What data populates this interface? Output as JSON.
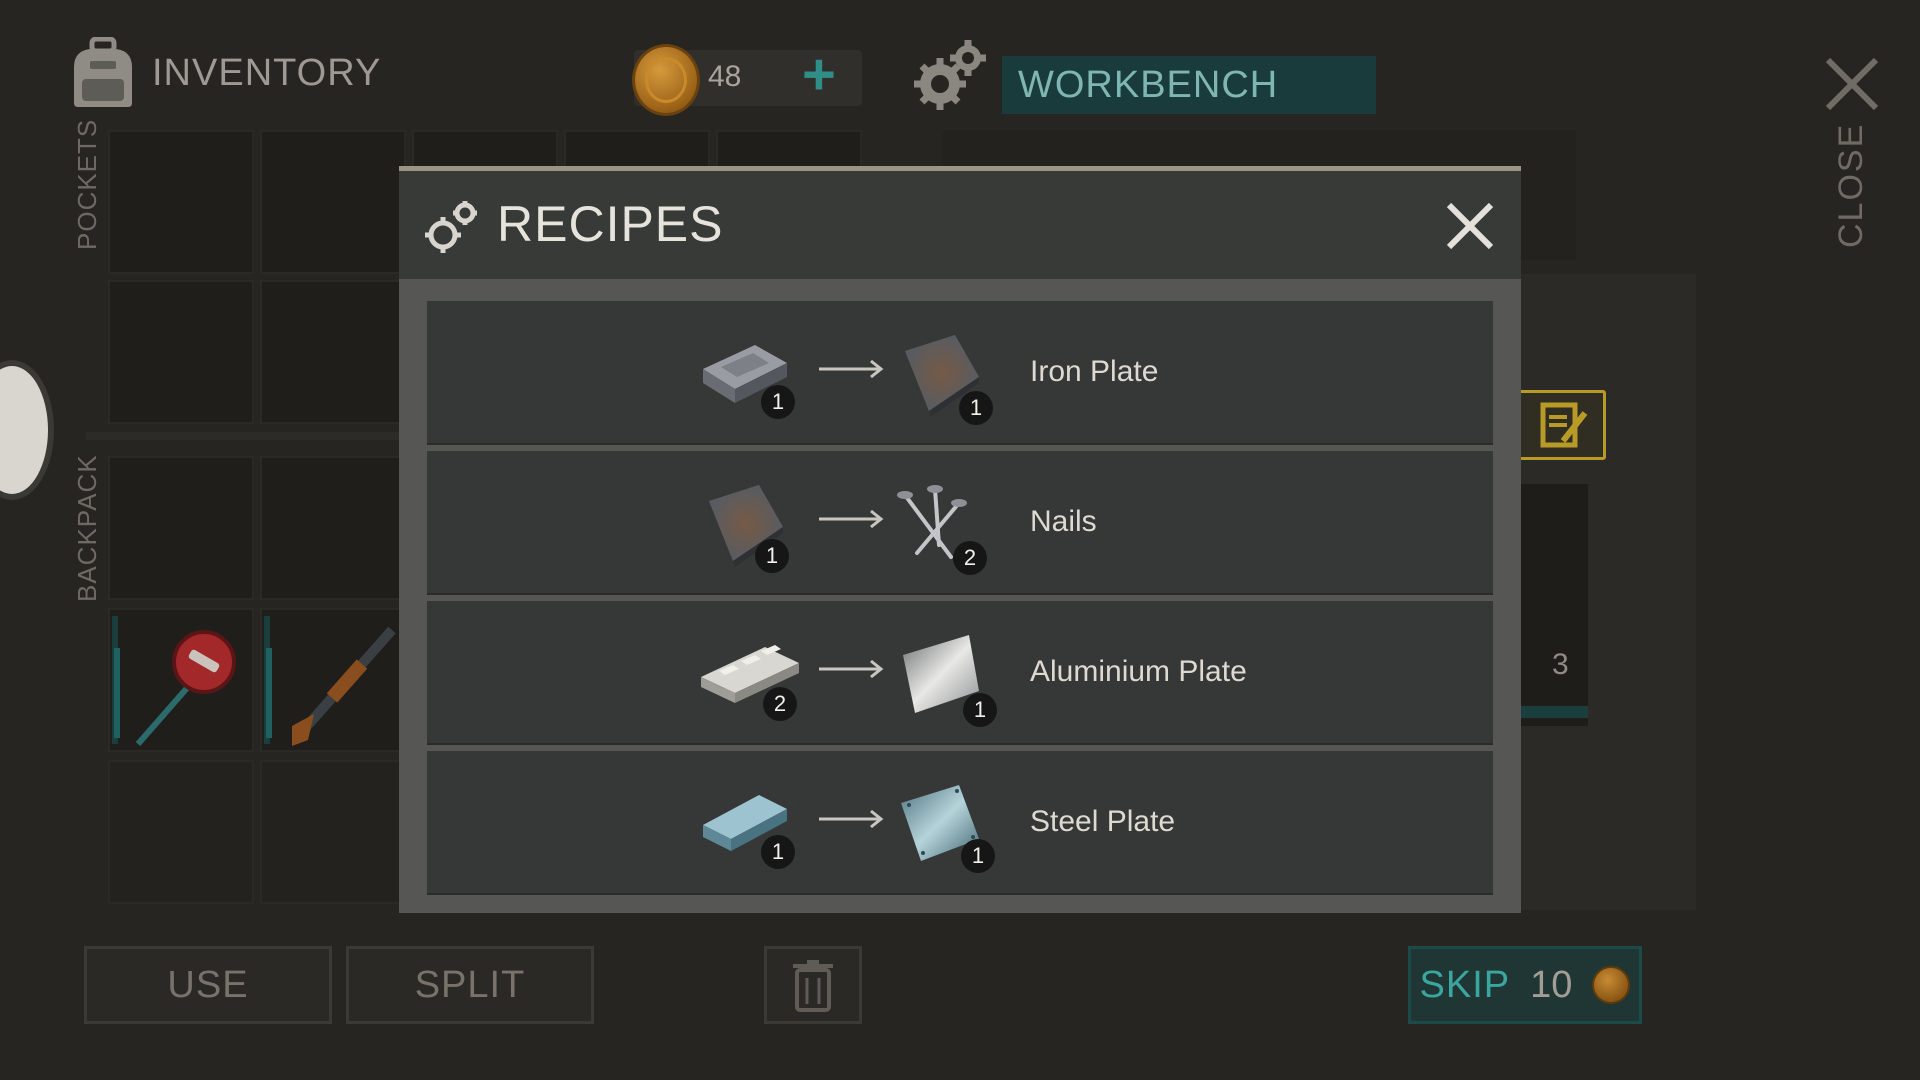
{
  "inventory": {
    "title": "INVENTORY",
    "pockets_label": "POCKETS",
    "backpack_label": "BACKPACK",
    "coins": "48",
    "add_label": "+"
  },
  "workbench": {
    "title": "WORKBENCH",
    "close_label": "CLOSE",
    "item_count": "3"
  },
  "actions": {
    "use_label": "USE",
    "split_label": "SPLIT",
    "skip_label": "SKIP",
    "skip_cost": "10"
  },
  "recipes_modal": {
    "title": "RECIPES",
    "recipes": [
      {
        "name": "Iron Plate",
        "input_icon": "iron-ingot-icon",
        "input_qty": "1",
        "output_icon": "iron-plate-icon",
        "output_qty": "1"
      },
      {
        "name": "Nails",
        "input_icon": "iron-plate-icon",
        "input_qty": "1",
        "output_icon": "nails-icon",
        "output_qty": "2"
      },
      {
        "name": "Aluminium Plate",
        "input_icon": "aluminium-bars-icon",
        "input_qty": "2",
        "output_icon": "aluminium-plate-icon",
        "output_qty": "1"
      },
      {
        "name": "Steel Plate",
        "input_icon": "steel-ingot-icon",
        "input_qty": "1",
        "output_icon": "steel-plate-icon",
        "output_qty": "1"
      }
    ]
  },
  "colors": {
    "accent_teal": "#2f8f88",
    "workbench_bg": "#193b3b",
    "note_border": "#b89a26",
    "modal_bg": "#565754",
    "row_bg": "#363837"
  }
}
